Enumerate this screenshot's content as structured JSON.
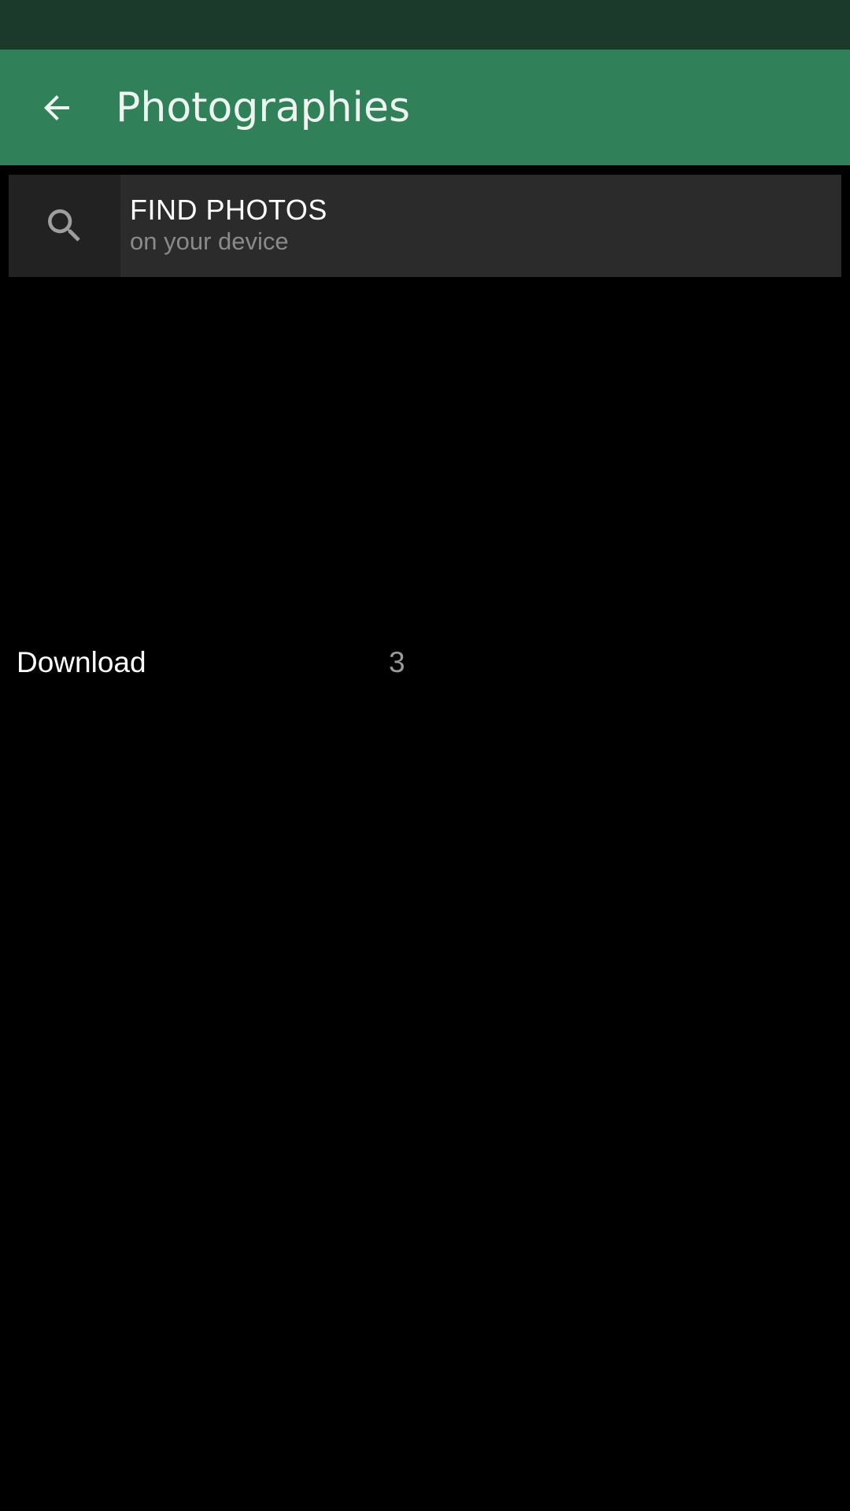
{
  "app_bar": {
    "title": "Photographies",
    "back_icon": "arrow-left-icon"
  },
  "find_photos": {
    "icon": "search-icon",
    "title": "FIND PHOTOS",
    "subtitle": "on your device"
  },
  "folders": [
    {
      "name": "Download",
      "count": "3"
    }
  ],
  "colors": {
    "status_bar": "#1b3a2b",
    "app_bar": "#30805a",
    "background": "#000000",
    "card": "#2b2b2b"
  }
}
